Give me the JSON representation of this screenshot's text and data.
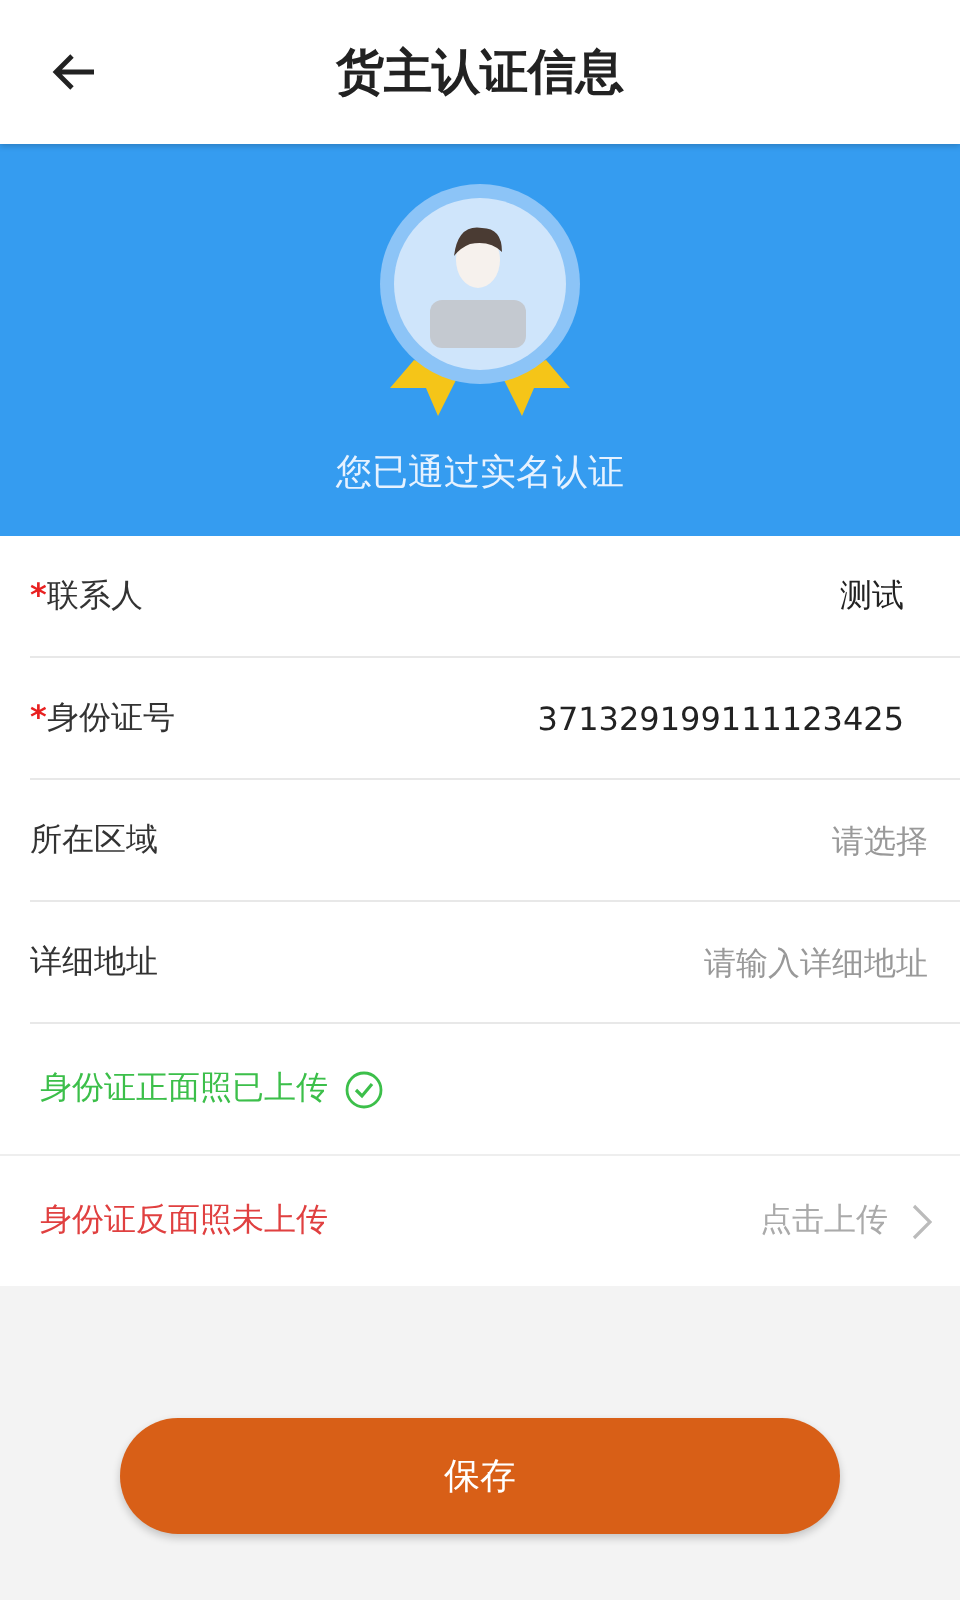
{
  "header": {
    "title": "货主认证信息"
  },
  "banner": {
    "status": "您已通过实名认证"
  },
  "fields": [
    {
      "label": "联系人",
      "required_mark": "*",
      "value": "测试"
    },
    {
      "label": "身份证号",
      "required_mark": "*",
      "value": "371329199111123425"
    },
    {
      "label": "所在区域",
      "placeholder": "请选择"
    },
    {
      "label": "详细地址",
      "placeholder": "请输入详细地址"
    }
  ],
  "uploads": [
    {
      "label": "身份证正面照已上传",
      "uploaded": true
    },
    {
      "label": "身份证反面照未上传",
      "uploaded": false,
      "action": "点击上传"
    }
  ],
  "save_button": "保存"
}
